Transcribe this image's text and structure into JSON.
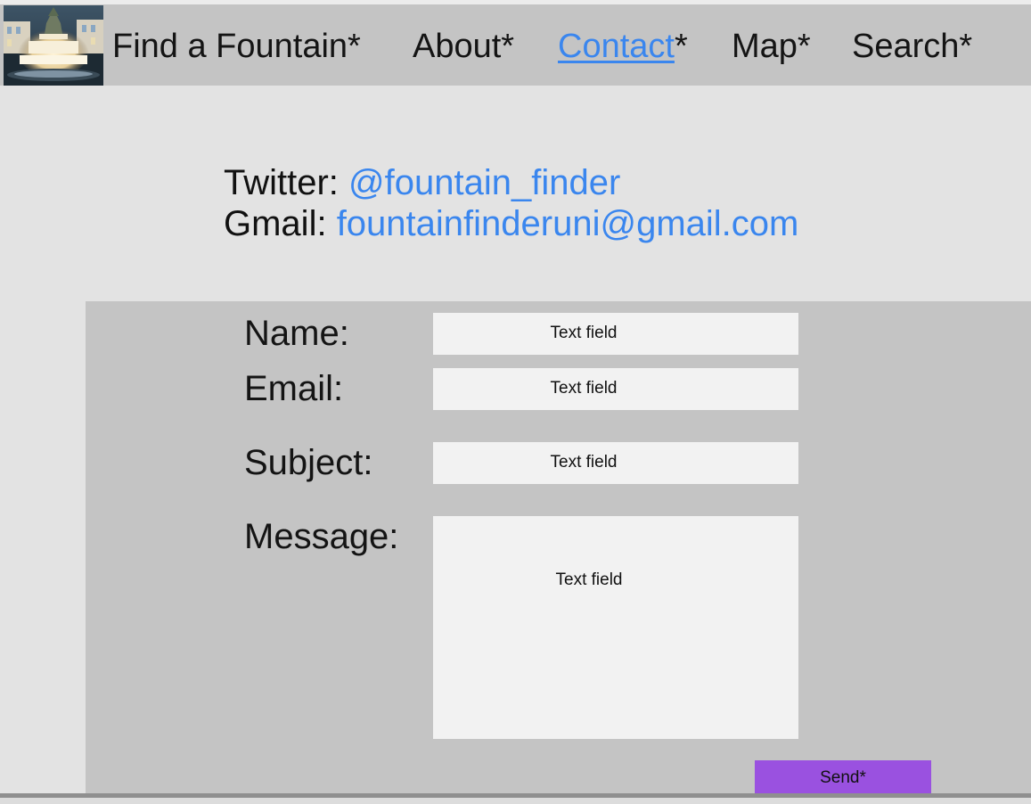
{
  "nav": {
    "items": [
      {
        "label": "Find a Fountain*"
      },
      {
        "label": "About*"
      },
      {
        "label": "Contact",
        "suffix": "*"
      },
      {
        "label": "Map*"
      },
      {
        "label": "Search*"
      }
    ]
  },
  "contact_info": {
    "twitter_label": "Twitter: ",
    "twitter_value": "@fountain_finder",
    "gmail_label": "Gmail: ",
    "gmail_value": "fountainfinderuni@gmail.com"
  },
  "form": {
    "name_label": "Name:",
    "email_label": "Email:",
    "subject_label": "Subject:",
    "message_label": "Message:",
    "name_field": "Text field",
    "email_field": "Text field",
    "subject_field": "Text field",
    "message_field": "Text field",
    "send_label": "Send*"
  },
  "colors": {
    "link": "#3a86ee",
    "send_button": "#9a51e0",
    "panel": "#c4c4c4",
    "background": "#e3e3e3"
  }
}
